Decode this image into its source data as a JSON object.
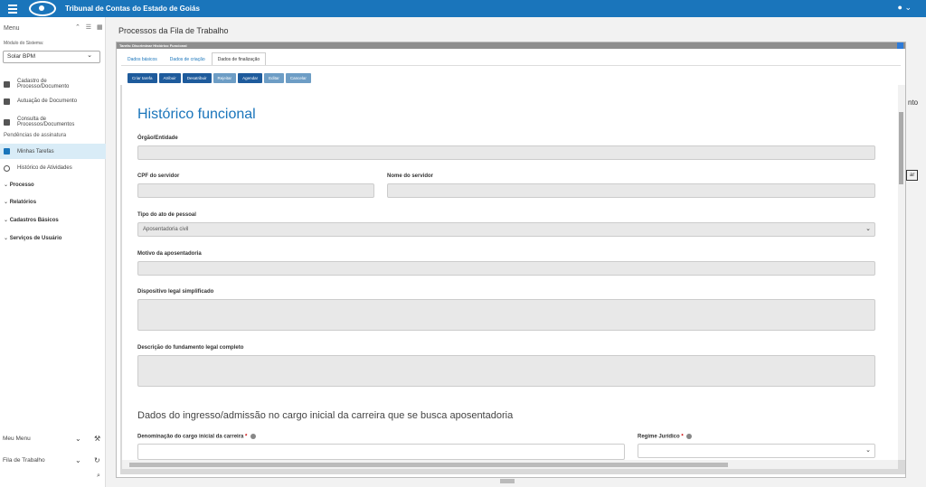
{
  "topbar": {
    "title": "Tribunal de Contas do Estado de Goiás",
    "user_icon": "user-circle-icon"
  },
  "sidebar": {
    "header": "Menu",
    "module_label": "Módulo do Sistema:",
    "module_value": "Solar BPM",
    "items": [
      {
        "label": "Cadastro de Processo/Documento"
      },
      {
        "label": "Autuação de Documento"
      },
      {
        "label": "Consulta de Processos/Documentos"
      }
    ],
    "section": "Pendências de assinatura",
    "tasks": "Minhas Tarefas",
    "history": "Histórico de Atividades",
    "groups": [
      "Processo",
      "Relatórios",
      "Cadastros Básicos",
      "Serviços de Usuário"
    ],
    "bottom": {
      "my_menu": "Meu Menu",
      "queue": "Fila de Trabalho"
    }
  },
  "main": {
    "title": "Processos da Fila de Trabalho",
    "bg_right_text": "nto",
    "bg_right_btn": "ar"
  },
  "modal": {
    "bar_title": "Tarefa: Discriminar Histórico Funcional",
    "tabs": [
      "Dados básicos",
      "Dados de criação",
      "Dados de finalização"
    ],
    "buttons": [
      {
        "label": "Criar tarefa",
        "enabled": true
      },
      {
        "label": "Atribuir",
        "enabled": true
      },
      {
        "label": "Desatribuir",
        "enabled": true
      },
      {
        "label": "Rejeitar",
        "enabled": false
      },
      {
        "label": "Agendar",
        "enabled": true
      },
      {
        "label": "Editar",
        "enabled": false
      },
      {
        "label": "Cancelar",
        "enabled": false
      }
    ],
    "form": {
      "heading": "Histórico funcional",
      "orgao": "Órgão/Entidade",
      "cpf": "CPF do servidor",
      "nome": "Nome do servidor",
      "tipo": "Tipo do ato de pessoal",
      "tipo_value": "Aposentadoria civil",
      "motivo": "Motivo da aposentadoria",
      "dispositivo": "Dispositivo legal simplificado",
      "descricao": "Descrição do fundamento legal completo",
      "section2": "Dados do ingresso/admissão no cargo inicial da carreira que se busca aposentadoria",
      "denominacao": "Denominação do cargo inicial da carreira",
      "regime": "Regime Jurídico",
      "required_mark": "*"
    }
  }
}
